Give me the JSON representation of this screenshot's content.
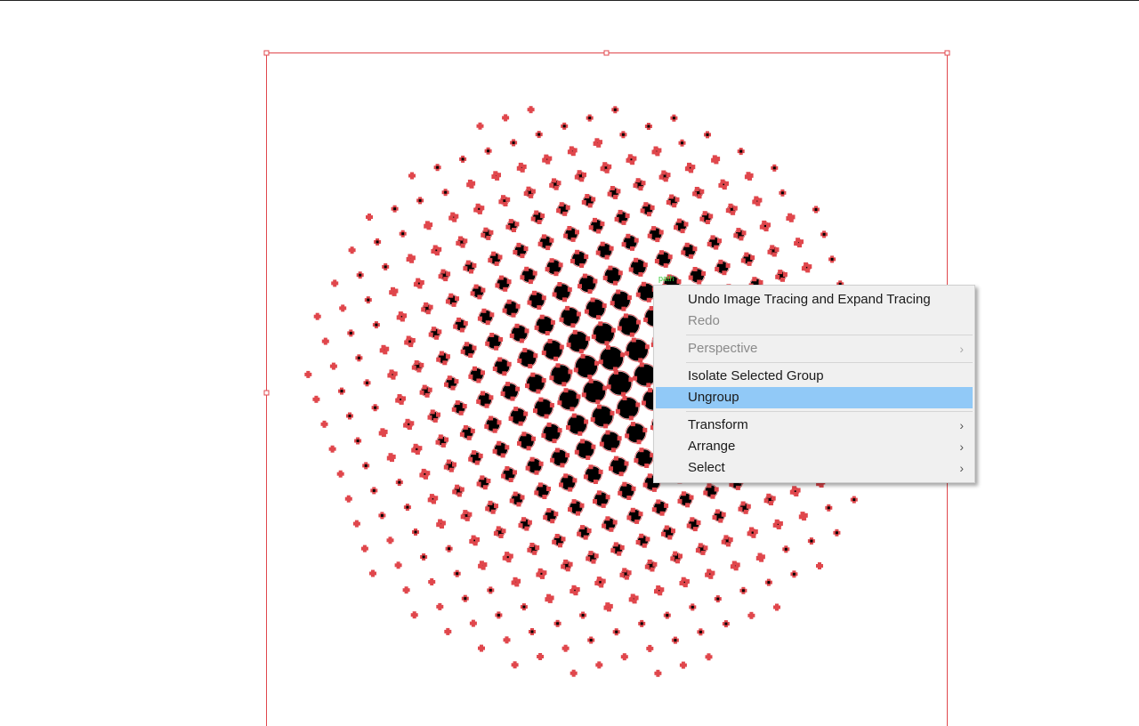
{
  "artwork": {
    "selection_color": "#e0474c",
    "dot_color": "#000000",
    "path_label": "path",
    "path_label_color": "#33cc33",
    "description_shape": "halftone-dot-circle"
  },
  "context_menu": {
    "items": [
      {
        "label": "Undo Image Tracing and Expand Tracing",
        "enabled": true,
        "submenu": false,
        "highlighted": false
      },
      {
        "label": "Redo",
        "enabled": false,
        "submenu": false,
        "highlighted": false
      },
      {
        "separator": true
      },
      {
        "label": "Perspective",
        "enabled": false,
        "submenu": true,
        "highlighted": false
      },
      {
        "separator": true
      },
      {
        "label": "Isolate Selected Group",
        "enabled": true,
        "submenu": false,
        "highlighted": false
      },
      {
        "label": "Ungroup",
        "enabled": true,
        "submenu": false,
        "highlighted": true
      },
      {
        "separator": true
      },
      {
        "label": "Transform",
        "enabled": true,
        "submenu": true,
        "highlighted": false
      },
      {
        "label": "Arrange",
        "enabled": true,
        "submenu": true,
        "highlighted": false
      },
      {
        "label": "Select",
        "enabled": true,
        "submenu": true,
        "highlighted": false
      }
    ],
    "highlight_color": "#91c9f7",
    "arrow_icon": "chevron-right-icon"
  }
}
